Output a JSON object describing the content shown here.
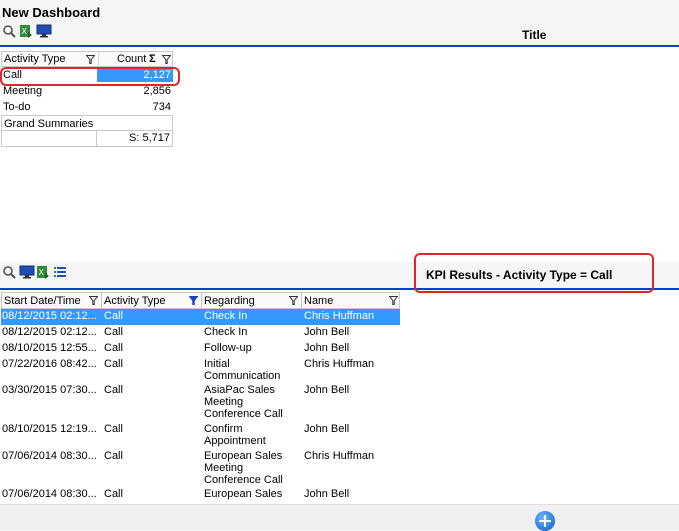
{
  "dashboard": {
    "title": "New Dashboard"
  },
  "top_pane": {
    "title": "Title",
    "toolbar": [
      "search-icon",
      "excel-export-icon",
      "monitor-icon"
    ],
    "pivot": {
      "col_activity_type": "Activity Type",
      "col_count": "Count",
      "rows": [
        {
          "label": "Call",
          "value": "2,127"
        },
        {
          "label": "Meeting",
          "value": "2,856"
        },
        {
          "label": "To-do",
          "value": "734"
        }
      ],
      "grand_label": "Grand Summaries",
      "grand_value": "S: 5,717"
    }
  },
  "bottom_pane": {
    "title": "KPI Results - Activity Type = Call",
    "toolbar": [
      "search-icon",
      "monitor-icon",
      "excel-export-icon",
      "list-icon"
    ],
    "columns": [
      "Start Date/Time",
      "Activity Type",
      "Regarding",
      "Name"
    ],
    "rows": [
      {
        "start": "08/12/2015 02:12...",
        "type": "Call",
        "regarding": "Check In",
        "name": "Chris Huffman"
      },
      {
        "start": "08/12/2015 02:12...",
        "type": "Call",
        "regarding": "Check In",
        "name": "John Bell"
      },
      {
        "start": "08/10/2015 12:55...",
        "type": "Call",
        "regarding": "Follow-up",
        "name": "John Bell"
      },
      {
        "start": "07/22/2016 08:42...",
        "type": "Call",
        "regarding": "Initial Communication",
        "name": "Chris Huffman"
      },
      {
        "start": "03/30/2015 07:30...",
        "type": "Call",
        "regarding": "AsiaPac Sales Meeting Conference Call",
        "name": "John Bell"
      },
      {
        "start": "08/10/2015 12:19...",
        "type": "Call",
        "regarding": "Confirm Appointment",
        "name": "John Bell"
      },
      {
        "start": "07/06/2014 08:30...",
        "type": "Call",
        "regarding": "European Sales Meeting Conference Call",
        "name": "Chris Huffman"
      },
      {
        "start": "07/06/2014 08:30...",
        "type": "Call",
        "regarding": "European Sales",
        "name": "John Bell"
      }
    ]
  },
  "colors": {
    "accent_blue": "#0b3fd1",
    "selection": "#3399ff",
    "highlight_red": "#e0262b"
  }
}
